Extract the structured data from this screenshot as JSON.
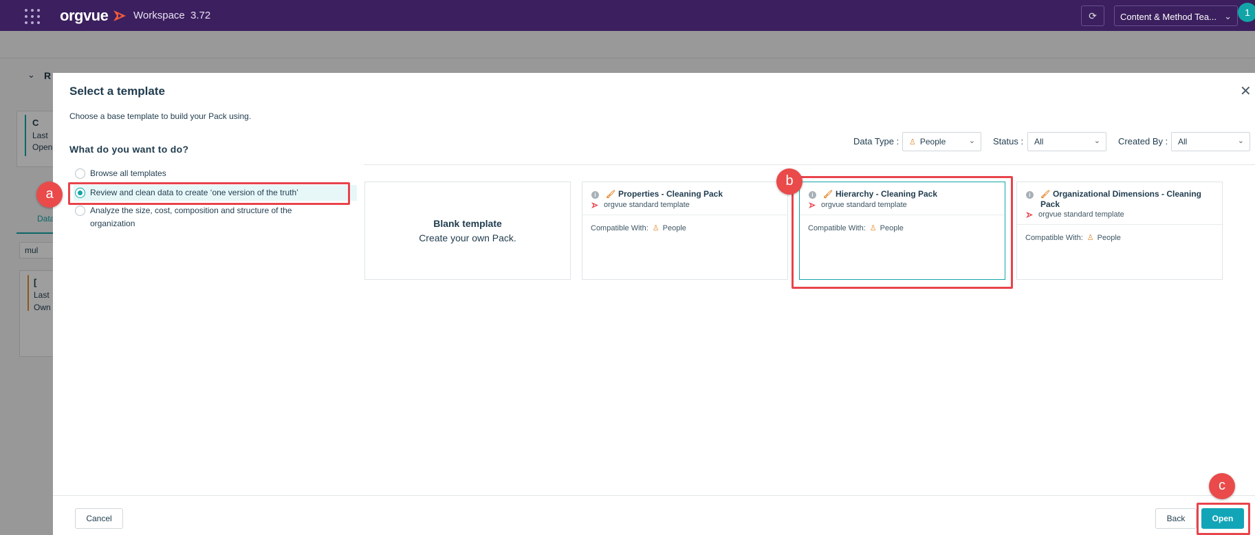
{
  "topbar": {
    "logo": "orgvue",
    "workspace_label": "Workspace",
    "version": "3.72",
    "team_select": "Content & Method Tea...",
    "avatar_text": "1",
    "brand_color": "#3b1f5e"
  },
  "background": {
    "section_letter": "R",
    "card1_line1": "C",
    "card1_line2": "Last",
    "card1_line3": "Open",
    "tab_label": "Data",
    "search_value": "mul",
    "card2_line1": "[",
    "card2_line2": "Last",
    "card2_line3": "Own"
  },
  "modal": {
    "title": "Select a template",
    "description": "Choose a base template to build your Pack using.",
    "question": "What do you want to do?",
    "options": [
      {
        "label": "Browse all templates",
        "selected": false
      },
      {
        "label": "Review and clean data to create ‘one version of the truth’",
        "selected": true
      },
      {
        "label": "Analyze the size, cost, composition and structure of the organization",
        "selected": false
      }
    ],
    "filters": {
      "data_type_label": "Data Type :",
      "data_type_value": "People",
      "status_label": "Status :",
      "status_value": "All",
      "created_by_label": "Created By :",
      "created_by_value": "All"
    },
    "blank_card": {
      "title": "Blank template",
      "subtitle": "Create your own Pack."
    },
    "templates": [
      {
        "title": "Properties - Cleaning Pack",
        "source": "orgvue standard template",
        "compat_label": "Compatible With:",
        "compat_value": "People",
        "selected": false
      },
      {
        "title": "Hierarchy - Cleaning Pack",
        "source": "orgvue standard template",
        "compat_label": "Compatible With:",
        "compat_value": "People",
        "selected": true
      },
      {
        "title": "Organizational Dimensions - Cleaning Pack",
        "source": "orgvue standard template",
        "compat_label": "Compatible With:",
        "compat_value": "People",
        "selected": false
      }
    ],
    "footer": {
      "cancel": "Cancel",
      "back": "Back",
      "open": "Open"
    },
    "accent_color": "#12a5b8"
  },
  "annotations": {
    "marker_a": "a",
    "marker_b": "b",
    "marker_c": "c",
    "highlight_color": "#e8434b"
  }
}
